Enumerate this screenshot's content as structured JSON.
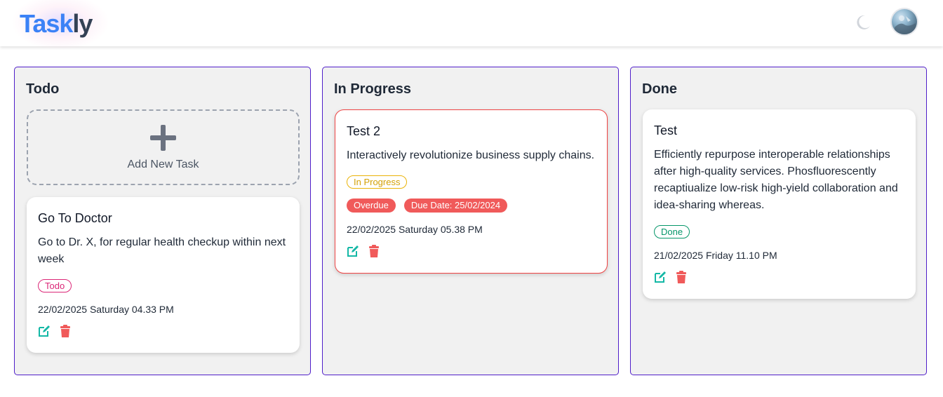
{
  "app": {
    "logo_part1": "Task",
    "logo_part2": "ly"
  },
  "header": {
    "theme_icon": "moon-icon",
    "avatar_icon": "user-avatar"
  },
  "colors": {
    "accent_blue": "#3b82f6",
    "column_border": "#4f1ec9",
    "todo": "#db2777",
    "in_progress": "#eab308",
    "done": "#059669",
    "overdue": "#f05a5a",
    "edit_icon": "#14b8a6",
    "delete_icon": "#f05a5a"
  },
  "columns": [
    {
      "title": "Todo",
      "add_label": "Add New Task",
      "cards": [
        {
          "title": "Go To Doctor",
          "description": "Go to Dr. X, for regular health checkup within next week",
          "status": "Todo",
          "date": "22/02/2025 Saturday 04.33 PM"
        }
      ]
    },
    {
      "title": "In Progress",
      "cards": [
        {
          "title": "Test 2",
          "description": "Interactively revolutionize business supply chains.",
          "status": "In Progress",
          "overdue_label": "Overdue",
          "due_date": "Due Date: 25/02/2024",
          "date": "22/02/2025 Saturday 05.38 PM"
        }
      ]
    },
    {
      "title": "Done",
      "cards": [
        {
          "title": "Test",
          "description": "Efficiently repurpose interoperable relationships after high-quality services. Phosfluorescently recaptiualize low-risk high-yield collaboration and idea-sharing whereas.",
          "status": "Done",
          "date": "21/02/2025 Friday 11.10 PM"
        }
      ]
    }
  ]
}
